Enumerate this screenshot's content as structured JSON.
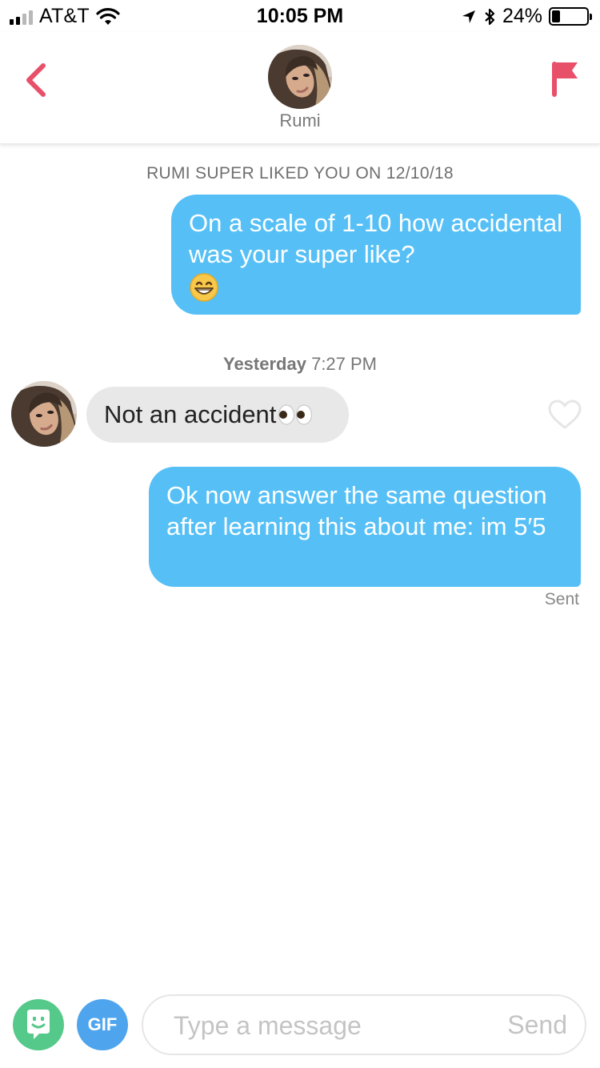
{
  "status_bar": {
    "carrier": "AT&T",
    "time": "10:05 PM",
    "battery_percent": "24%",
    "battery_level": 0.24,
    "signal_bars": 2,
    "icons": [
      "signal-icon",
      "wifi-icon",
      "location-arrow-icon",
      "bluetooth-icon",
      "battery-icon"
    ]
  },
  "header": {
    "match_name": "Rumi",
    "icons": {
      "back": "chevron-left-icon",
      "report": "flag-icon"
    },
    "accent_color": "#e8506a"
  },
  "conversation": {
    "system_note": "RUMI SUPER LIKED YOU ON 12/10/18",
    "messages": [
      {
        "direction": "outgoing",
        "text": "On a scale of 1-10 how accidental was your super like?",
        "emoji": "grinning-face-emoji"
      },
      {
        "direction": "incoming",
        "text": "Not an accident",
        "emoji": "eyes-emoji",
        "timestamp_day": "Yesterday",
        "timestamp_time": "7:27 PM"
      },
      {
        "direction": "outgoing",
        "text": "Ok now answer the same question after learning this about me: im 5′5",
        "status": "Sent"
      }
    ],
    "outgoing_bubble_color": "#56c0f6",
    "incoming_bubble_color": "#e8e8e8"
  },
  "composer": {
    "gif_label": "GIF",
    "placeholder": "Type a message",
    "value": "",
    "send_label": "Send",
    "icons": {
      "sticker": "bitmoji-icon"
    }
  }
}
